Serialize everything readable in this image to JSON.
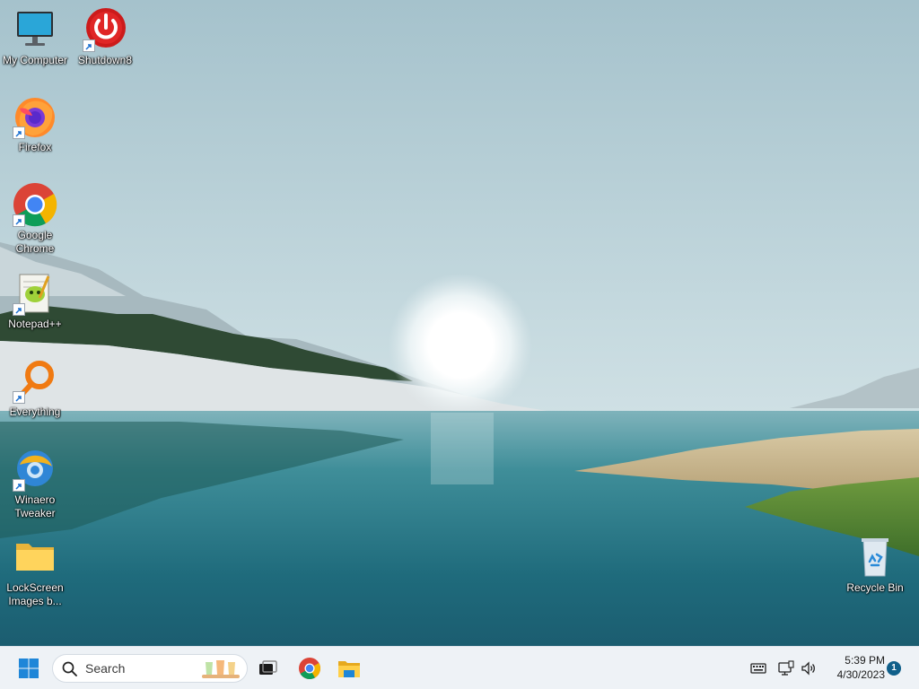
{
  "desktop": {
    "icons": [
      {
        "label": "My Computer",
        "icon": "monitor-icon"
      },
      {
        "label": "Shutdown8",
        "icon": "power-icon"
      },
      {
        "label": "Firefox",
        "icon": "firefox-icon"
      },
      {
        "label": "Google\nChrome",
        "icon": "chrome-icon"
      },
      {
        "label": "Notepad++",
        "icon": "notepadpp-icon"
      },
      {
        "label": "Everything",
        "icon": "magnifier-icon"
      },
      {
        "label": "Winaero\nTweaker",
        "icon": "winaero-icon"
      },
      {
        "label": "LockScreen\nImages b...",
        "icon": "folder-icon"
      },
      {
        "label": "Recycle Bin",
        "icon": "recycle-bin-icon"
      }
    ]
  },
  "taskbar": {
    "search_label": "Search",
    "apps": [
      "start-icon",
      "task-view-icon",
      "chrome-icon",
      "file-explorer-icon"
    ],
    "tray": [
      "keyboard-icon",
      "network-icon",
      "volume-icon"
    ],
    "time": "5:39 PM",
    "date": "4/30/2023",
    "notification_count": "1"
  },
  "colors": {
    "sky_top": "#a9c6cf",
    "sky_horizon": "#dfe9ec",
    "water": "#2f7f8f",
    "taskbar_bg": "#eef2f6",
    "badge": "#0f5f8a"
  }
}
